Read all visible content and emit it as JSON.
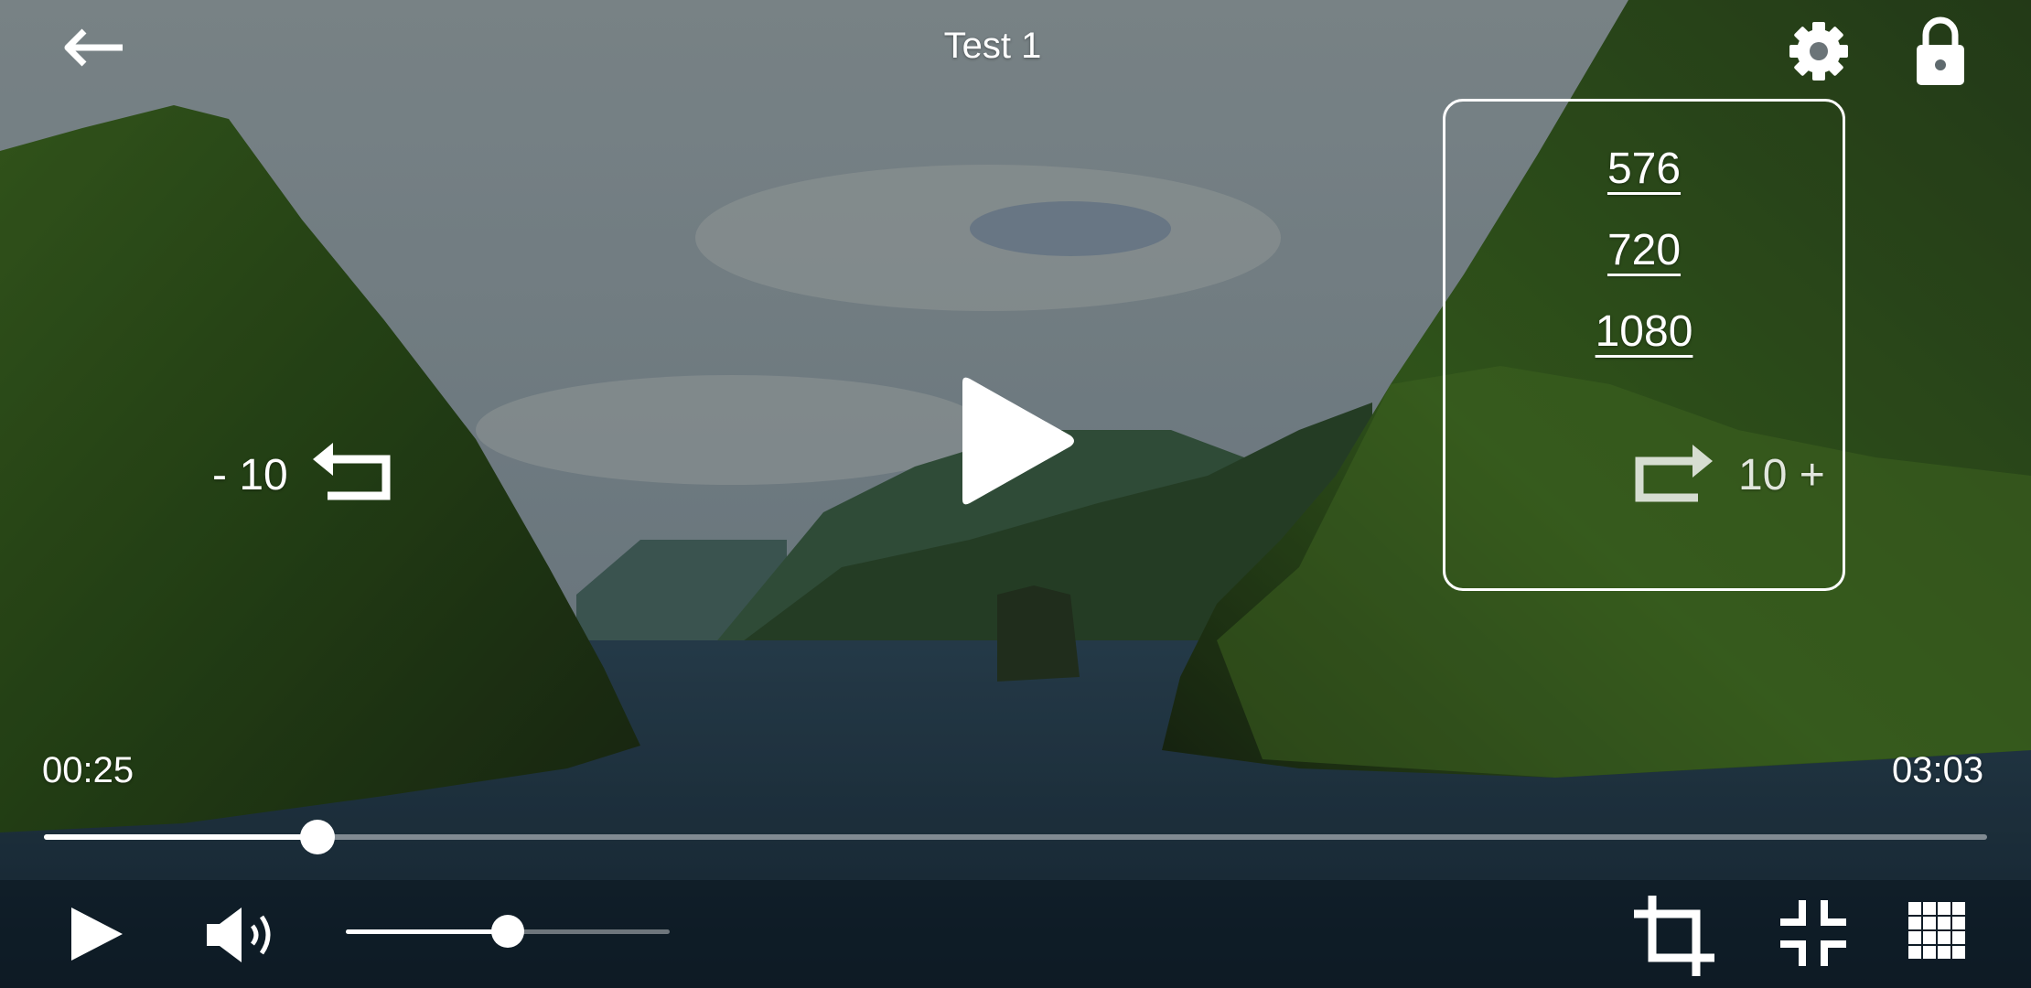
{
  "header": {
    "title": "Test 1"
  },
  "icons": {
    "back": "arrow-left-icon",
    "settings": "gear-icon",
    "lock": "lock-icon",
    "center_play": "play-icon",
    "rewind": "replay-arrow-icon",
    "forward": "forward-arrow-icon",
    "bottom_play": "play-icon",
    "volume": "volume-icon",
    "crop": "crop-icon",
    "exit_fullscreen": "fullscreen-exit-icon",
    "grid": "grid-icon"
  },
  "resolution_menu": {
    "options": [
      "576",
      "720",
      "1080"
    ]
  },
  "seek": {
    "rewind_label": "- 10",
    "forward_label": "10 +"
  },
  "playback": {
    "current_time": "00:25",
    "total_time": "03:03",
    "progress_fraction": 0.141
  },
  "volume": {
    "level_fraction": 0.5
  },
  "colors": {
    "overlay_text": "#ffffff",
    "progress_track": "#a7aeb4",
    "progress_fill": "#ffffff"
  }
}
